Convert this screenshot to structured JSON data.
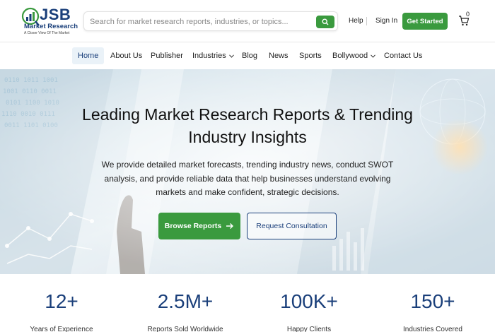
{
  "brand": {
    "name": "JSB",
    "subtitle": "Market Research",
    "tagline": "A Closer View Of The Market",
    "primary_color": "#1a3f7a",
    "accent_color": "#3a9a3e"
  },
  "header": {
    "search_placeholder": "Search for market research reports, industries, or topics...",
    "search_icon": "search-icon",
    "help": "Help",
    "signin": "Sign In",
    "get_started": "Get Started",
    "cart_count": "0"
  },
  "nav": {
    "home": "Home",
    "about": "About Us",
    "publisher": "Publisher",
    "industries": "Industries",
    "blog": "Blog",
    "news": "News",
    "sports": "Sports",
    "bollywood": "Bollywood",
    "contact": "Contact Us"
  },
  "hero": {
    "title_line1": "Leading Market Research Reports & Trending",
    "title_line2": "Industry Insights",
    "desc_line1": "We provide detailed market forecasts, trending industry news, conduct SWOT",
    "desc_line2": "analysis, and provide reliable data that help businesses understand evolving",
    "desc_line3": "markets and make confident, strategic decisions.",
    "browse_label": "Browse Reports",
    "consult_label": "Request Consultation"
  },
  "stats": [
    {
      "value": "12+",
      "label": "Years of Experience"
    },
    {
      "value": "2.5M+",
      "label": "Reports Sold Worldwide"
    },
    {
      "value": "100K+",
      "label": "Happy Clients"
    },
    {
      "value": "150+",
      "label": "Industries Covered"
    }
  ]
}
